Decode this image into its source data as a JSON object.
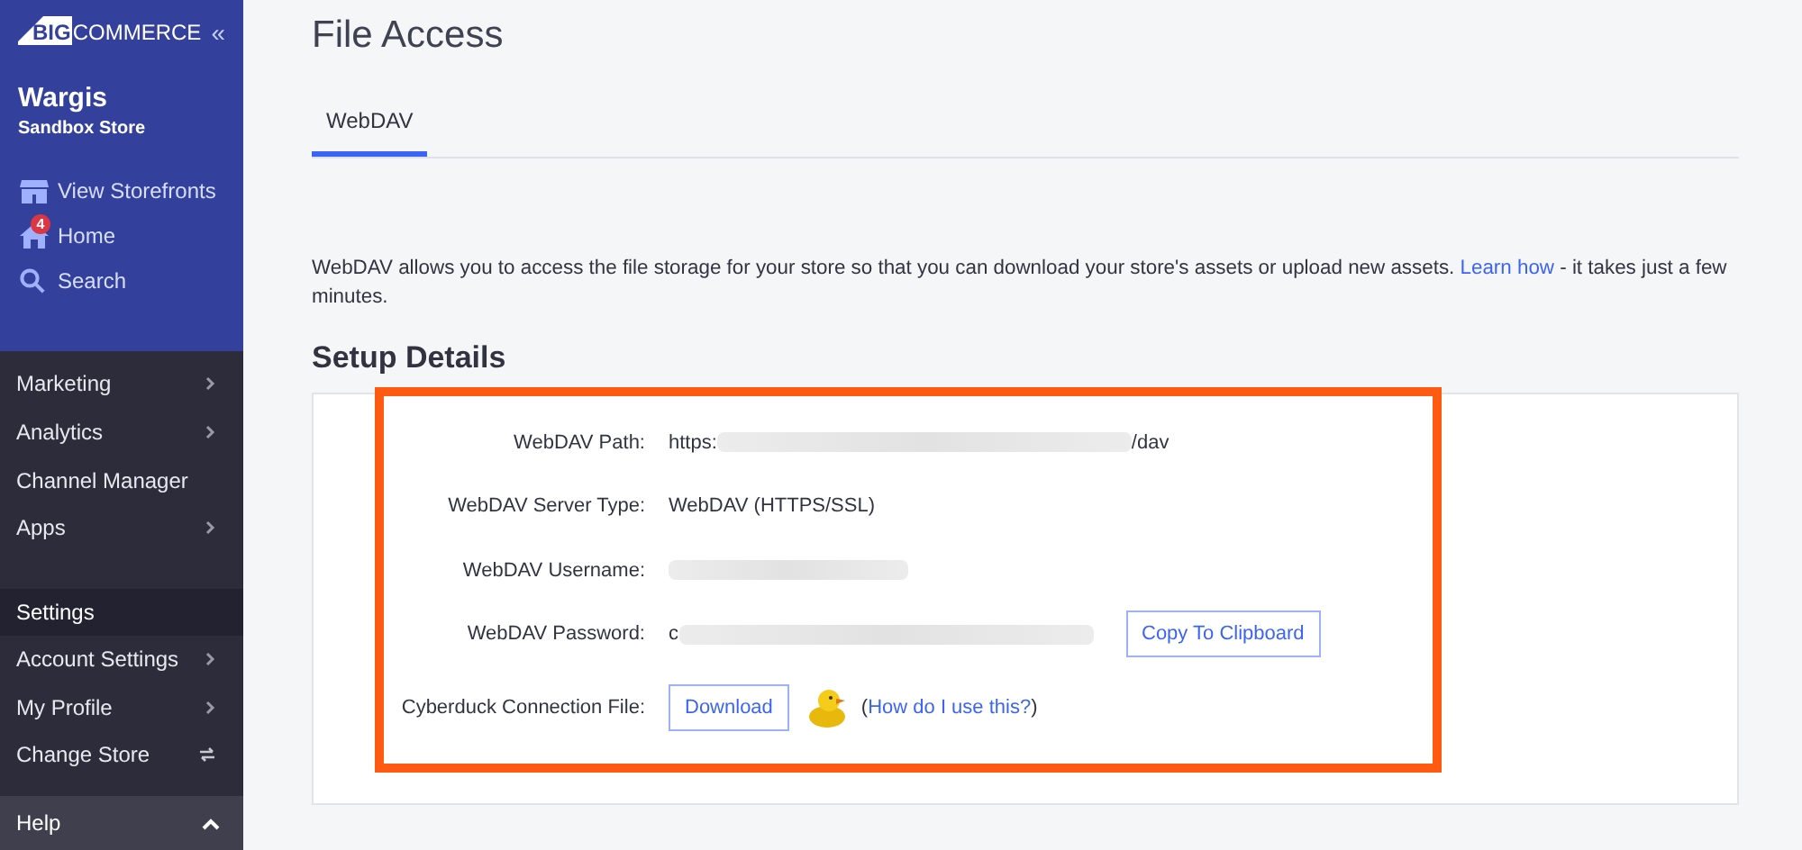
{
  "sidebar": {
    "logo": {
      "mark": "BIG",
      "rest": "COMMERCE"
    },
    "collapse_icon": "«",
    "store": {
      "name": "Wargis",
      "subtitle": "Sandbox Store"
    },
    "quick_links": [
      {
        "kind": "storefront",
        "label": "View Storefronts"
      },
      {
        "kind": "home",
        "label": "Home",
        "badge": "4"
      },
      {
        "kind": "search",
        "label": "Search"
      }
    ],
    "menu": [
      {
        "kind": "submenu",
        "label": "Marketing"
      },
      {
        "kind": "submenu",
        "label": "Analytics"
      },
      {
        "kind": "plain",
        "label": "Channel Manager"
      },
      {
        "kind": "submenu",
        "label": "Apps"
      },
      {
        "kind": "header",
        "label": "Settings"
      },
      {
        "kind": "submenu",
        "label": "Account Settings"
      },
      {
        "kind": "submenu",
        "label": "My Profile"
      },
      {
        "kind": "switch",
        "label": "Change Store"
      }
    ],
    "help": {
      "label": "Help",
      "expanded": true
    }
  },
  "page": {
    "title": "File Access",
    "tabs": [
      {
        "label": "WebDAV",
        "selected": true
      }
    ],
    "intro": {
      "text_before": "WebDAV allows you to access the file storage for your store so that you can download your store's assets or upload new assets.",
      "link": "Learn how",
      "text_after": "- it takes just a few minutes."
    },
    "section_title": "Setup Details",
    "fields": [
      {
        "kind": "redacted",
        "label": "WebDAV Path:",
        "value_start": "https:",
        "value_end": "/dav"
      },
      {
        "kind": "text",
        "label": "WebDAV Server Type:",
        "value": "WebDAV (HTTPS/SSL)"
      },
      {
        "kind": "redacted",
        "label": "WebDAV Username:"
      },
      {
        "kind": "redacted",
        "label": "WebDAV Password:",
        "value_start": "c",
        "action": "Copy To Clipboard"
      },
      {
        "kind": "download",
        "label": "Cyberduck Connection File:",
        "action": "Download",
        "help_before": "(",
        "help_link": "How do I use this?",
        "help_after": ")"
      }
    ]
  }
}
